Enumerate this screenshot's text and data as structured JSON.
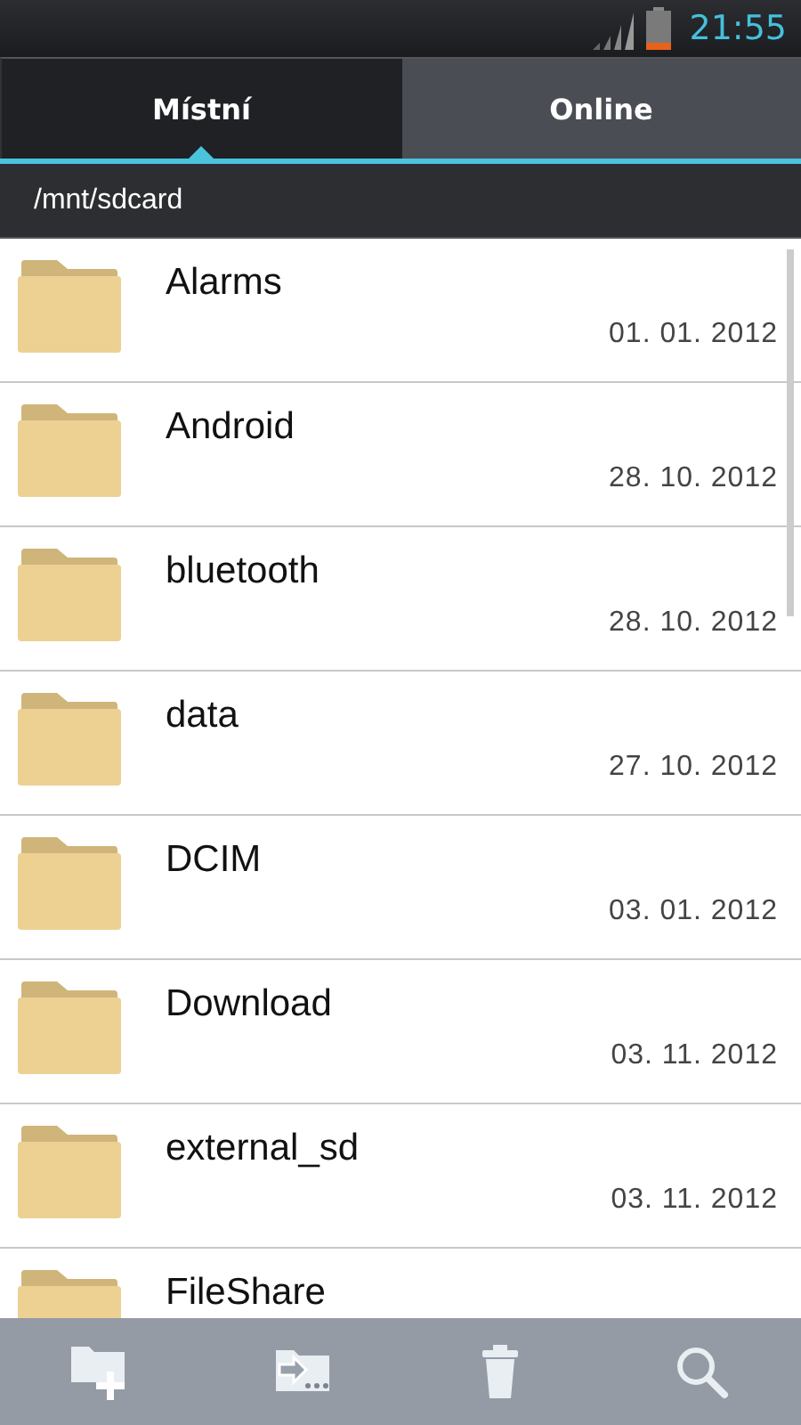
{
  "status_bar": {
    "time": "21:55"
  },
  "tabs": [
    {
      "label": "Místní",
      "selected": true
    },
    {
      "label": "Online",
      "selected": false
    }
  ],
  "path": "/mnt/sdcard",
  "files": [
    {
      "name": "Alarms",
      "date": "01. 01. 2012"
    },
    {
      "name": "Android",
      "date": "28. 10. 2012"
    },
    {
      "name": "bluetooth",
      "date": "28. 10. 2012"
    },
    {
      "name": "data",
      "date": "27. 10. 2012"
    },
    {
      "name": "DCIM",
      "date": "03. 01. 2012"
    },
    {
      "name": "Download",
      "date": "03. 11. 2012"
    },
    {
      "name": "external_sd",
      "date": "03. 11. 2012"
    },
    {
      "name": "FileShare"
    }
  ],
  "toolbar": [
    {
      "kind": "new-folder"
    },
    {
      "kind": "move"
    },
    {
      "kind": "delete"
    },
    {
      "kind": "search"
    }
  ]
}
